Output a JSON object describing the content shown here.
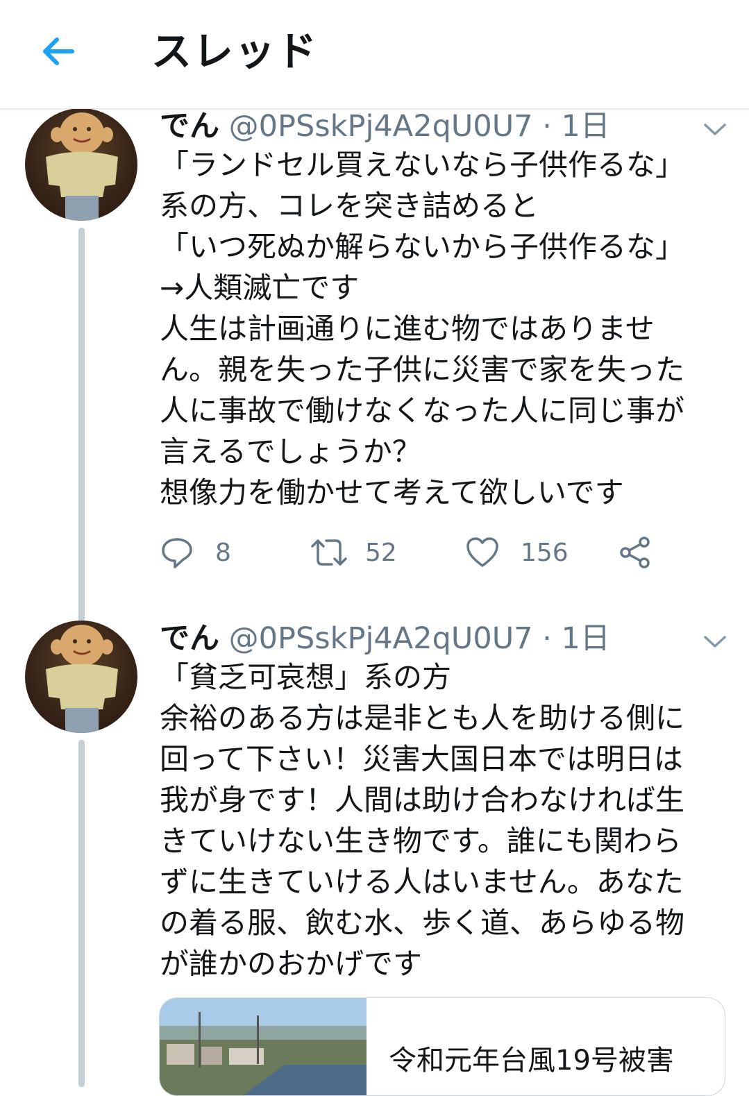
{
  "header": {
    "title": "スレッド",
    "back_icon": "arrow-left-icon",
    "accent": "#1da1f2"
  },
  "tweets": [
    {
      "name": "でん",
      "handle": "@0PSskPj4A2qU0U7",
      "separator": "·",
      "time": "1日",
      "text": "「ランドセル買えないなら子供作るな」\n系の方、コレを突き詰めると\n「いつ死ぬか解らないから子供作るな」\n→人類滅亡です\n人生は計画通りに進む物ではありませ\nん。親を失った子供に災害で家を失った\n人に事故で働けなくなった人に同じ事が\n言えるでしょうか？\n想像力を働かせて考えて欲しいです",
      "replies": "8",
      "retweets": "52",
      "likes": "156"
    },
    {
      "name": "でん",
      "handle": "@0PSskPj4A2qU0U7",
      "separator": "·",
      "time": "1日",
      "text": "「貧乏可哀想」系の方\n余裕のある方は是非とも人を助ける側に\n回って下さい！災害大国日本では明日は\n我が身です！人間は助け合わなければ生\nきていけない生き物です。誰にも関わら\nずに生きていける人はいません。あなた\nの着る服、飲む水、歩く道、あらゆる物\nが誰かのおかげです",
      "card_title": "令和元年台風19号被害"
    }
  ],
  "colors": {
    "text": "#14171a",
    "secondary": "#657786",
    "thread_line": "#c4cfd6",
    "border": "#e1e8ed"
  }
}
